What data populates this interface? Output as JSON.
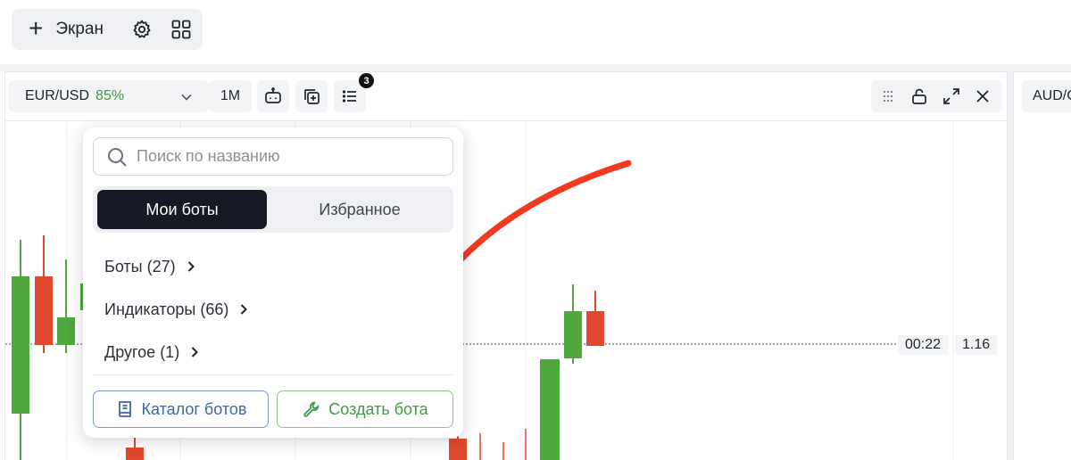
{
  "topbar": {
    "add_screen_label": "Экран",
    "icons": [
      "plus-icon",
      "gear-icon",
      "grid-icon"
    ]
  },
  "panel": {
    "pair": "EUR/USD",
    "pair_percent": "85%",
    "timeframe": "1M",
    "badge_count": "3",
    "second_pair": "AUD/C"
  },
  "chart": {
    "time_tag": "00:22",
    "price_tag": "1.16",
    "colors": {
      "up": "#4ea83e",
      "down": "#e0492e"
    }
  },
  "dropdown": {
    "search_placeholder": "Поиск по названию",
    "tab_my_bots": "Мои боты",
    "tab_favorites": "Избранное",
    "items": [
      {
        "label": "Боты (27)"
      },
      {
        "label": "Индикаторы (66)"
      },
      {
        "label": "Другое (1)"
      }
    ],
    "catalog_button": "Каталог ботов",
    "create_button": "Создать бота"
  },
  "annotation": {
    "arrow_color": "#f23a1f"
  }
}
